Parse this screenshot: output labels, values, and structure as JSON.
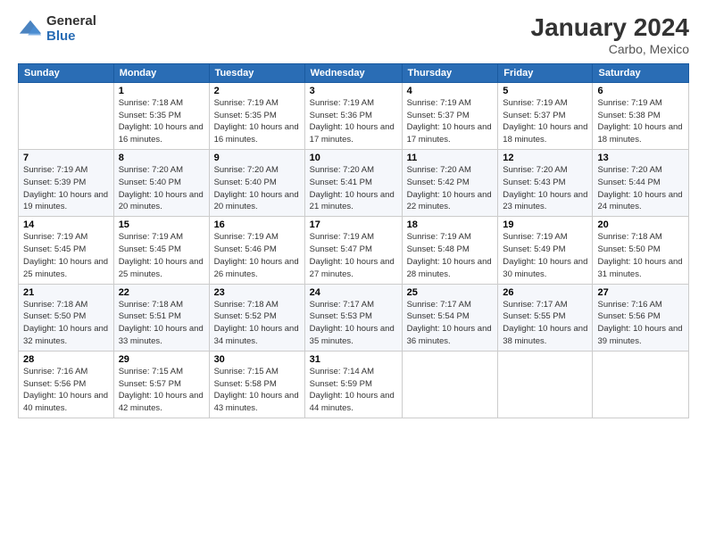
{
  "logo": {
    "general": "General",
    "blue": "Blue"
  },
  "title": "January 2024",
  "subtitle": "Carbo, Mexico",
  "days_header": [
    "Sunday",
    "Monday",
    "Tuesday",
    "Wednesday",
    "Thursday",
    "Friday",
    "Saturday"
  ],
  "weeks": [
    [
      {
        "num": "",
        "sunrise": "",
        "sunset": "",
        "daylight": ""
      },
      {
        "num": "1",
        "sunrise": "Sunrise: 7:18 AM",
        "sunset": "Sunset: 5:35 PM",
        "daylight": "Daylight: 10 hours and 16 minutes."
      },
      {
        "num": "2",
        "sunrise": "Sunrise: 7:19 AM",
        "sunset": "Sunset: 5:35 PM",
        "daylight": "Daylight: 10 hours and 16 minutes."
      },
      {
        "num": "3",
        "sunrise": "Sunrise: 7:19 AM",
        "sunset": "Sunset: 5:36 PM",
        "daylight": "Daylight: 10 hours and 17 minutes."
      },
      {
        "num": "4",
        "sunrise": "Sunrise: 7:19 AM",
        "sunset": "Sunset: 5:37 PM",
        "daylight": "Daylight: 10 hours and 17 minutes."
      },
      {
        "num": "5",
        "sunrise": "Sunrise: 7:19 AM",
        "sunset": "Sunset: 5:37 PM",
        "daylight": "Daylight: 10 hours and 18 minutes."
      },
      {
        "num": "6",
        "sunrise": "Sunrise: 7:19 AM",
        "sunset": "Sunset: 5:38 PM",
        "daylight": "Daylight: 10 hours and 18 minutes."
      }
    ],
    [
      {
        "num": "7",
        "sunrise": "Sunrise: 7:19 AM",
        "sunset": "Sunset: 5:39 PM",
        "daylight": "Daylight: 10 hours and 19 minutes."
      },
      {
        "num": "8",
        "sunrise": "Sunrise: 7:20 AM",
        "sunset": "Sunset: 5:40 PM",
        "daylight": "Daylight: 10 hours and 20 minutes."
      },
      {
        "num": "9",
        "sunrise": "Sunrise: 7:20 AM",
        "sunset": "Sunset: 5:40 PM",
        "daylight": "Daylight: 10 hours and 20 minutes."
      },
      {
        "num": "10",
        "sunrise": "Sunrise: 7:20 AM",
        "sunset": "Sunset: 5:41 PM",
        "daylight": "Daylight: 10 hours and 21 minutes."
      },
      {
        "num": "11",
        "sunrise": "Sunrise: 7:20 AM",
        "sunset": "Sunset: 5:42 PM",
        "daylight": "Daylight: 10 hours and 22 minutes."
      },
      {
        "num": "12",
        "sunrise": "Sunrise: 7:20 AM",
        "sunset": "Sunset: 5:43 PM",
        "daylight": "Daylight: 10 hours and 23 minutes."
      },
      {
        "num": "13",
        "sunrise": "Sunrise: 7:20 AM",
        "sunset": "Sunset: 5:44 PM",
        "daylight": "Daylight: 10 hours and 24 minutes."
      }
    ],
    [
      {
        "num": "14",
        "sunrise": "Sunrise: 7:19 AM",
        "sunset": "Sunset: 5:45 PM",
        "daylight": "Daylight: 10 hours and 25 minutes."
      },
      {
        "num": "15",
        "sunrise": "Sunrise: 7:19 AM",
        "sunset": "Sunset: 5:45 PM",
        "daylight": "Daylight: 10 hours and 25 minutes."
      },
      {
        "num": "16",
        "sunrise": "Sunrise: 7:19 AM",
        "sunset": "Sunset: 5:46 PM",
        "daylight": "Daylight: 10 hours and 26 minutes."
      },
      {
        "num": "17",
        "sunrise": "Sunrise: 7:19 AM",
        "sunset": "Sunset: 5:47 PM",
        "daylight": "Daylight: 10 hours and 27 minutes."
      },
      {
        "num": "18",
        "sunrise": "Sunrise: 7:19 AM",
        "sunset": "Sunset: 5:48 PM",
        "daylight": "Daylight: 10 hours and 28 minutes."
      },
      {
        "num": "19",
        "sunrise": "Sunrise: 7:19 AM",
        "sunset": "Sunset: 5:49 PM",
        "daylight": "Daylight: 10 hours and 30 minutes."
      },
      {
        "num": "20",
        "sunrise": "Sunrise: 7:18 AM",
        "sunset": "Sunset: 5:50 PM",
        "daylight": "Daylight: 10 hours and 31 minutes."
      }
    ],
    [
      {
        "num": "21",
        "sunrise": "Sunrise: 7:18 AM",
        "sunset": "Sunset: 5:50 PM",
        "daylight": "Daylight: 10 hours and 32 minutes."
      },
      {
        "num": "22",
        "sunrise": "Sunrise: 7:18 AM",
        "sunset": "Sunset: 5:51 PM",
        "daylight": "Daylight: 10 hours and 33 minutes."
      },
      {
        "num": "23",
        "sunrise": "Sunrise: 7:18 AM",
        "sunset": "Sunset: 5:52 PM",
        "daylight": "Daylight: 10 hours and 34 minutes."
      },
      {
        "num": "24",
        "sunrise": "Sunrise: 7:17 AM",
        "sunset": "Sunset: 5:53 PM",
        "daylight": "Daylight: 10 hours and 35 minutes."
      },
      {
        "num": "25",
        "sunrise": "Sunrise: 7:17 AM",
        "sunset": "Sunset: 5:54 PM",
        "daylight": "Daylight: 10 hours and 36 minutes."
      },
      {
        "num": "26",
        "sunrise": "Sunrise: 7:17 AM",
        "sunset": "Sunset: 5:55 PM",
        "daylight": "Daylight: 10 hours and 38 minutes."
      },
      {
        "num": "27",
        "sunrise": "Sunrise: 7:16 AM",
        "sunset": "Sunset: 5:56 PM",
        "daylight": "Daylight: 10 hours and 39 minutes."
      }
    ],
    [
      {
        "num": "28",
        "sunrise": "Sunrise: 7:16 AM",
        "sunset": "Sunset: 5:56 PM",
        "daylight": "Daylight: 10 hours and 40 minutes."
      },
      {
        "num": "29",
        "sunrise": "Sunrise: 7:15 AM",
        "sunset": "Sunset: 5:57 PM",
        "daylight": "Daylight: 10 hours and 42 minutes."
      },
      {
        "num": "30",
        "sunrise": "Sunrise: 7:15 AM",
        "sunset": "Sunset: 5:58 PM",
        "daylight": "Daylight: 10 hours and 43 minutes."
      },
      {
        "num": "31",
        "sunrise": "Sunrise: 7:14 AM",
        "sunset": "Sunset: 5:59 PM",
        "daylight": "Daylight: 10 hours and 44 minutes."
      },
      {
        "num": "",
        "sunrise": "",
        "sunset": "",
        "daylight": ""
      },
      {
        "num": "",
        "sunrise": "",
        "sunset": "",
        "daylight": ""
      },
      {
        "num": "",
        "sunrise": "",
        "sunset": "",
        "daylight": ""
      }
    ]
  ]
}
